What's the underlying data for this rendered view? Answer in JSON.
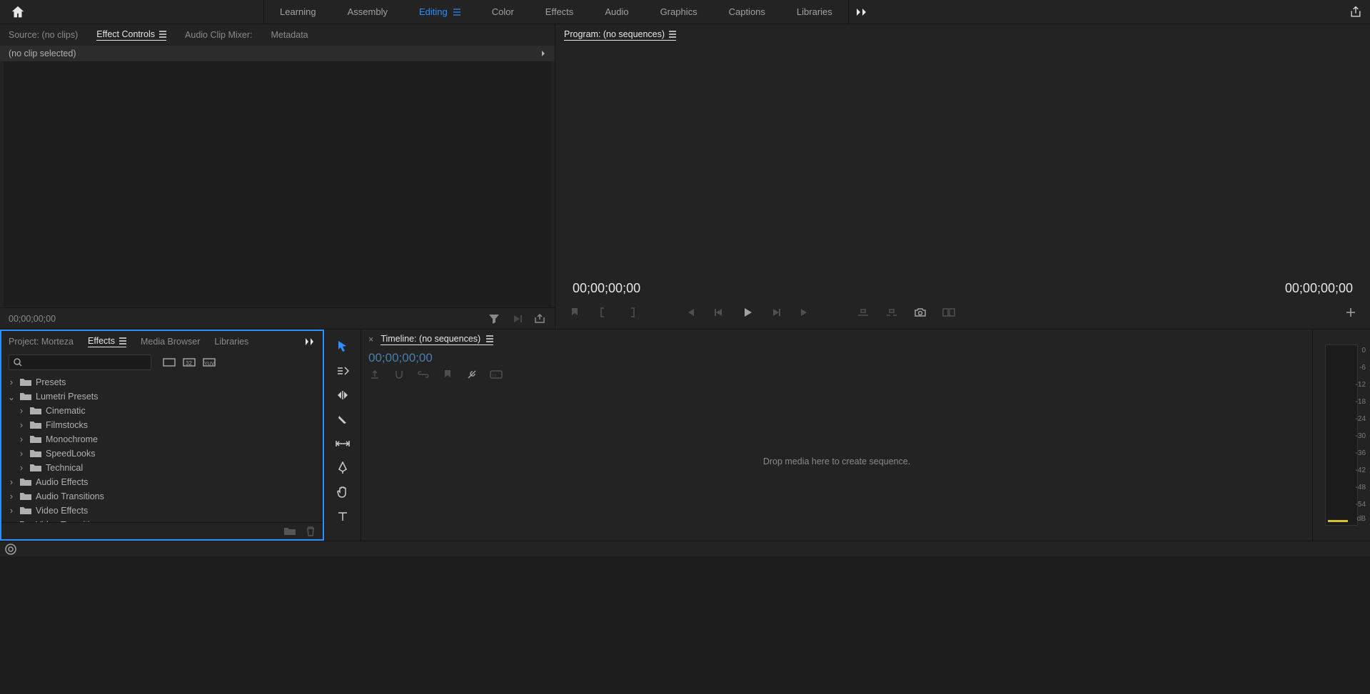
{
  "workspaces": [
    "Learning",
    "Assembly",
    "Editing",
    "Color",
    "Effects",
    "Audio",
    "Graphics",
    "Captions",
    "Libraries"
  ],
  "active_workspace": "Editing",
  "source": {
    "tabs": [
      "Source: (no clips)",
      "Effect Controls",
      "Audio Clip Mixer:",
      "Metadata"
    ],
    "active_tab": "Effect Controls",
    "no_clip": "(no clip selected)",
    "timecode": "00;00;00;00"
  },
  "program": {
    "title": "Program: (no sequences)",
    "tc_left": "00;00;00;00",
    "tc_right": "00;00;00;00"
  },
  "project": {
    "tabs": [
      "Project: Morteza",
      "Effects",
      "Media Browser",
      "Libraries"
    ],
    "active_tab": "Effects",
    "search_placeholder": "",
    "tree": [
      {
        "label": "Presets",
        "level": 0,
        "expanded": false,
        "bin": true
      },
      {
        "label": "Lumetri Presets",
        "level": 0,
        "expanded": true,
        "bin": true
      },
      {
        "label": "Cinematic",
        "level": 1,
        "expanded": false,
        "bin": true
      },
      {
        "label": "Filmstocks",
        "level": 1,
        "expanded": false,
        "bin": true
      },
      {
        "label": "Monochrome",
        "level": 1,
        "expanded": false,
        "bin": true
      },
      {
        "label": "SpeedLooks",
        "level": 1,
        "expanded": false,
        "bin": true
      },
      {
        "label": "Technical",
        "level": 1,
        "expanded": false,
        "bin": true
      },
      {
        "label": "Audio Effects",
        "level": 0,
        "expanded": false,
        "bin": true
      },
      {
        "label": "Audio Transitions",
        "level": 0,
        "expanded": false,
        "bin": true
      },
      {
        "label": "Video Effects",
        "level": 0,
        "expanded": false,
        "bin": true
      },
      {
        "label": "Video Transitions",
        "level": 0,
        "expanded": false,
        "bin": true
      }
    ]
  },
  "timeline": {
    "title": "Timeline: (no sequences)",
    "tc": "00;00;00;00",
    "drop_hint": "Drop media here to create sequence."
  },
  "meter": {
    "ticks": [
      "0",
      "-6",
      "-12",
      "-18",
      "-24",
      "-30",
      "-36",
      "-42",
      "-48",
      "-54",
      "dB"
    ]
  }
}
